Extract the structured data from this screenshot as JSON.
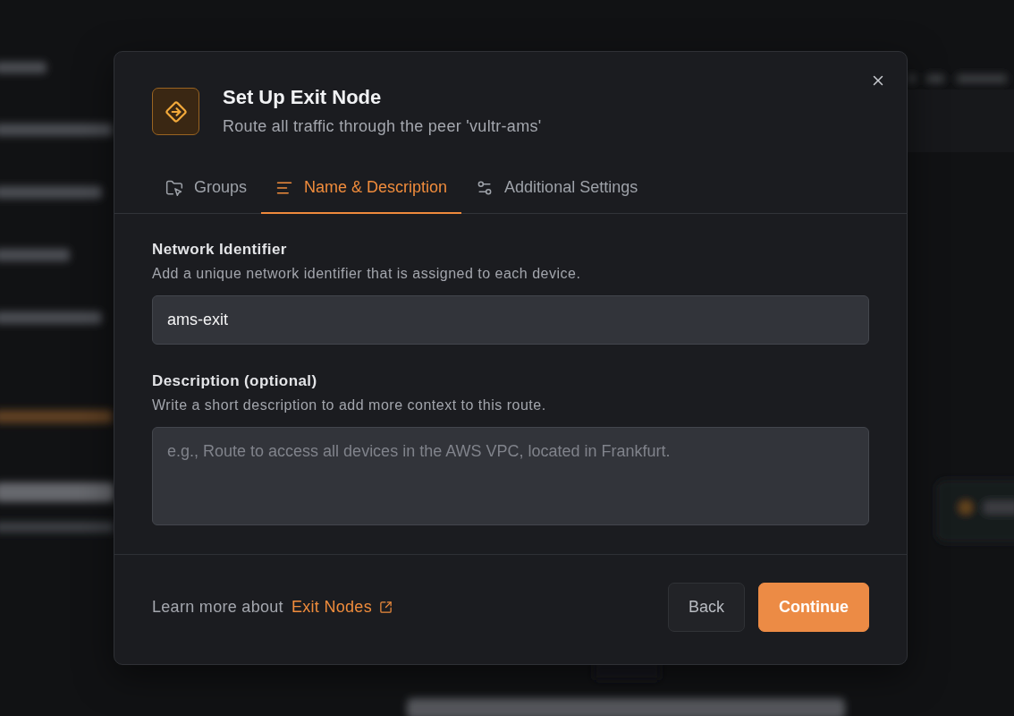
{
  "dialog": {
    "title": "Set Up Exit Node",
    "subtitle": "Route all traffic through the peer 'vultr-ams'"
  },
  "tabs": [
    {
      "label": "Groups",
      "kind": "groups",
      "selected": false
    },
    {
      "label": "Name & Description",
      "kind": "text",
      "selected": true
    },
    {
      "label": "Additional Settings",
      "kind": "settings",
      "selected": false
    }
  ],
  "fields": [
    {
      "kind": "input",
      "label": "Network Identifier",
      "help": "Add a unique network identifier that is assigned to each device.",
      "value": "ams-exit"
    },
    {
      "kind": "textarea",
      "label": "Description (optional)",
      "help": "Write a short description to add more context to this route.",
      "placeholder": "e.g., Route to access all devices in the AWS VPC, located in Frankfurt."
    }
  ],
  "footer": {
    "text": "Learn more about",
    "link": "Exit Nodes"
  },
  "buttons": [
    {
      "label": "Back",
      "kind": "secondary"
    },
    {
      "label": "Continue",
      "kind": "primary"
    }
  ]
}
